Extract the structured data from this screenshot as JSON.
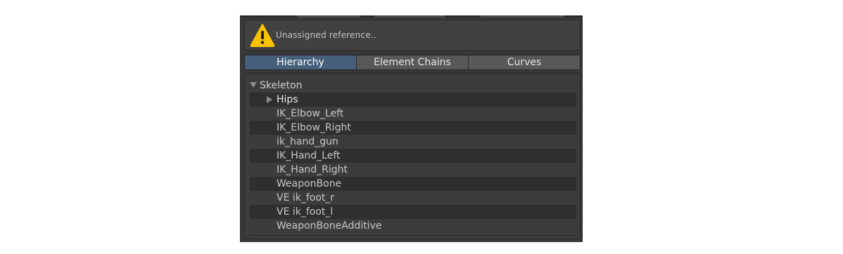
{
  "helpbox": {
    "icon": "warning-icon",
    "message": "Unassigned reference.."
  },
  "tabs": [
    {
      "label": "Hierarchy",
      "active": true
    },
    {
      "label": "Element Chains",
      "active": false
    },
    {
      "label": "Curves",
      "active": false
    }
  ],
  "tree": {
    "root_label": "Skeleton",
    "items": [
      {
        "label": "Hips",
        "expandable": true
      },
      {
        "label": "IK_Elbow_Left",
        "expandable": false
      },
      {
        "label": "IK_Elbow_Right",
        "expandable": false
      },
      {
        "label": "ik_hand_gun",
        "expandable": false
      },
      {
        "label": "IK_Hand_Left",
        "expandable": false
      },
      {
        "label": "IK_Hand_Right",
        "expandable": false
      },
      {
        "label": "WeaponBone",
        "expandable": false
      },
      {
        "label": "VE ik_foot_r",
        "expandable": false
      },
      {
        "label": "VE ik_foot_l",
        "expandable": false
      },
      {
        "label": "WeaponBoneAdditive",
        "expandable": false
      }
    ]
  },
  "colors": {
    "panel_bg": "#383838",
    "active_tab": "#46607c",
    "tab_bg": "#585858",
    "warning_yellow": "#f7c300"
  }
}
